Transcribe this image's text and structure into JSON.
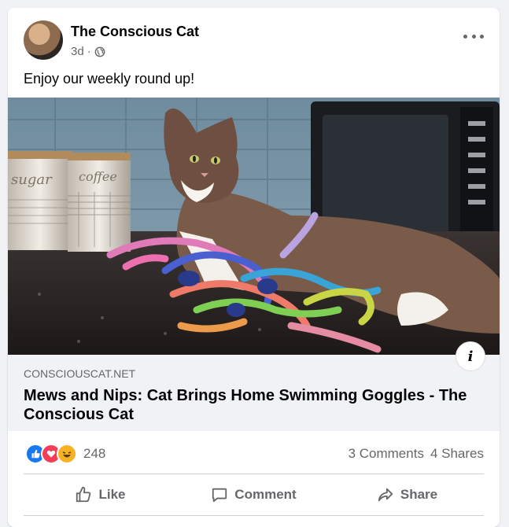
{
  "post": {
    "page_name": "The Conscious Cat",
    "time": "3d",
    "separator": "·",
    "audience_icon": "globe-icon",
    "more_icon": "more-options-icon",
    "text": "Enjoy our weekly round up!"
  },
  "link": {
    "domain": "CONSCIOUSCAT.NET",
    "title": "Mews and Nips: Cat Brings Home Swimming Goggles - The Conscious Cat",
    "info_label": "i"
  },
  "stats": {
    "reaction_icons": [
      "like-reaction-icon",
      "love-reaction-icon",
      "haha-reaction-icon"
    ],
    "reaction_count": "248",
    "comments": "3 Comments",
    "shares": "4 Shares"
  },
  "actions": {
    "like": "Like",
    "comment": "Comment",
    "share": "Share"
  },
  "image_text": {
    "canister_1": "sugar",
    "canister_2": "coffee"
  },
  "colors": {
    "brand_blue": "#1877f2",
    "love_red": "#f33e58",
    "haha_yellow": "#f7b125",
    "secondary_text": "#65676b"
  }
}
